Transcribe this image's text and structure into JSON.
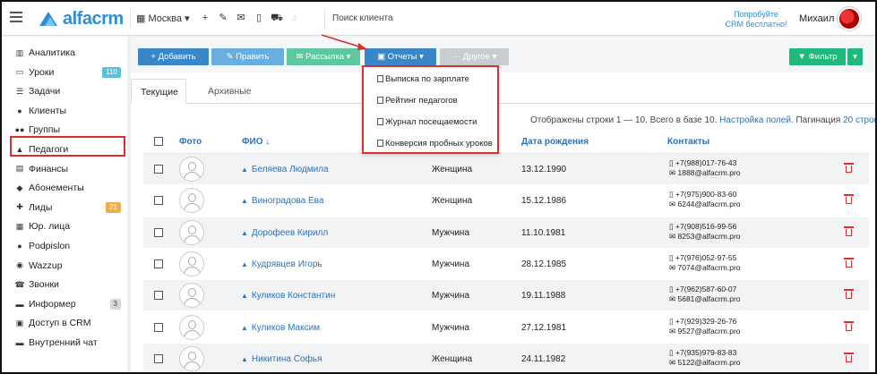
{
  "header": {
    "logo_text": "alfacrm",
    "branch": "Москва",
    "search_placeholder": "Поиск клиента",
    "promo_line1": "Попробуйте",
    "promo_line2": "CRM бесплатно!",
    "user_name": "Михаил"
  },
  "sidebar": {
    "items": [
      {
        "icon": "chart-icon",
        "label": "Аналитика"
      },
      {
        "icon": "desktop-icon",
        "label": "Уроки",
        "badge": "110"
      },
      {
        "icon": "tasks-icon",
        "label": "Задачи"
      },
      {
        "icon": "user-icon",
        "label": "Клиенты"
      },
      {
        "icon": "users-icon",
        "label": "Группы"
      },
      {
        "icon": "graduation-cap-icon",
        "label": "Педагоги"
      },
      {
        "icon": "money-icon",
        "label": "Финансы"
      },
      {
        "icon": "tag-icon",
        "label": "Абонементы"
      },
      {
        "icon": "person-add-icon",
        "label": "Лиды",
        "badge": "21"
      },
      {
        "icon": "building-icon",
        "label": "Юр. лица"
      },
      {
        "icon": "podpislon-icon",
        "label": "Podpislon"
      },
      {
        "icon": "whatsapp-icon",
        "label": "Wazzup"
      },
      {
        "icon": "phone-icon",
        "label": "Звонки"
      },
      {
        "icon": "informer-icon",
        "label": "Информер",
        "badge": "3"
      },
      {
        "icon": "lock-icon",
        "label": "Доступ в CRM"
      },
      {
        "icon": "chat-icon",
        "label": "Внутренний чат"
      }
    ]
  },
  "toolbar": {
    "add": "+ Добавить",
    "edit": "✎ Править",
    "mail": "✉ Рассылка ▾",
    "reports": "▣ Отчеты ▾",
    "other": "··· Другое ▾",
    "filter": "▼ Фильтр",
    "filter_caret": "▾"
  },
  "reports_menu": [
    "Выписка по зарплате",
    "Рейтинг педагогов",
    "Журнал посещаемости",
    "Конверсия пробных уроков"
  ],
  "tabs": {
    "current": "Текущие",
    "archived": "Архивные"
  },
  "meta": {
    "rows_info": "Отображены строки 1 — 10. Всего в базе 10.",
    "columns_link": "Настройка полей.",
    "pagination_label": "Пагинация",
    "pagination_link": "20 строк"
  },
  "table": {
    "headers": {
      "photo": "Фото",
      "fio": "ФИО ↓",
      "dob": "Дата рождения",
      "contacts": "Контакты"
    },
    "rows": [
      {
        "name": "Беляева Людмила",
        "gender": "Женщина",
        "dob": "13.12.1990",
        "phone": "+7(988)017-76-43",
        "email": "1888@alfacrm.pro"
      },
      {
        "name": "Виноградова Ева",
        "gender": "Женщина",
        "dob": "15.12.1986",
        "phone": "+7(975)900-83-60",
        "email": "6244@alfacrm.pro"
      },
      {
        "name": "Дорофеев Кирилл",
        "gender": "Мужчина",
        "dob": "11.10.1981",
        "phone": "+7(908)516-99-56",
        "email": "8253@alfacrm.pro"
      },
      {
        "name": "Кудрявцев Игорь",
        "gender": "Мужчина",
        "dob": "28.12.1985",
        "phone": "+7(976)052-97-55",
        "email": "7074@alfacrm.pro"
      },
      {
        "name": "Куликов Константин",
        "gender": "Мужчина",
        "dob": "19.11.1988",
        "phone": "+7(962)587-60-07",
        "email": "5681@alfacrm.pro"
      },
      {
        "name": "Куликов Максим",
        "gender": "Мужчина",
        "dob": "27.12.1981",
        "phone": "+7(929)329-26-76",
        "email": "9527@alfacrm.pro"
      },
      {
        "name": "Никитина Софья",
        "gender": "Женщина",
        "dob": "24.11.1982",
        "phone": "+7(935)979-83-83",
        "email": "5122@alfacrm.pro"
      }
    ]
  },
  "colors": {
    "accent": "#3a87c7",
    "highlight": "#d9302c",
    "filter": "#1fb87d"
  }
}
